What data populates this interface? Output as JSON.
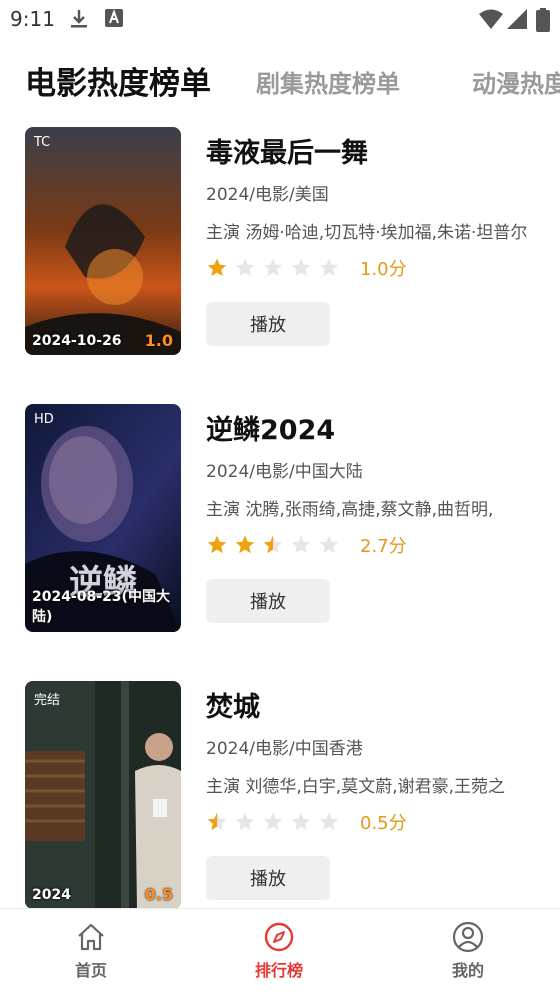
{
  "status_bar": {
    "time": "9:11",
    "icons": [
      "download-icon",
      "a-notification-icon",
      "wifi-icon",
      "signal-icon",
      "battery-icon"
    ]
  },
  "tabs": [
    {
      "label": "电影热度榜单",
      "active": true
    },
    {
      "label": "剧集热度榜单",
      "active": false
    },
    {
      "label": "动漫热度",
      "active": false
    }
  ],
  "movies": [
    {
      "title": "毒液最后一舞",
      "meta": "2024/电影/美国",
      "cast": "主演 汤姆·哈迪,切瓦特·埃加福,朱诺·坦普尔",
      "rating_value": 1.0,
      "rating_text": "1.0分",
      "play_label": "播放",
      "poster_tag": "TC",
      "poster_date": "2024-10-26",
      "poster_score": "1.0"
    },
    {
      "title": "逆鳞2024",
      "meta": "2024/电影/中国大陆",
      "cast": "主演 沈腾,张雨绮,高捷,蔡文静,曲哲明,",
      "rating_value": 2.7,
      "rating_text": "2.7分",
      "play_label": "播放",
      "poster_tag": "HD",
      "poster_date": "2024-08-23(中国大陆)",
      "poster_score": ""
    },
    {
      "title": "焚城",
      "meta": "2024/电影/中国香港",
      "cast": "主演 刘德华,白宇,莫文蔚,谢君豪,王菀之",
      "rating_value": 0.5,
      "rating_text": "0.5分",
      "play_label": "播放",
      "poster_tag": "完结",
      "poster_date": "2024",
      "poster_score": "0.5"
    }
  ],
  "bottom_nav": {
    "items": [
      {
        "label": "首页",
        "icon": "home-icon",
        "active": false
      },
      {
        "label": "排行榜",
        "icon": "compass-icon",
        "active": true
      },
      {
        "label": "我的",
        "icon": "user-icon",
        "active": false
      }
    ]
  },
  "colors": {
    "star_filled": "#f0a20e",
    "star_empty": "#e6e6e6",
    "rating_text": "#e39a16",
    "nav_active": "#e53935",
    "nav_inactive": "#666666",
    "button_bg": "#efefef"
  }
}
